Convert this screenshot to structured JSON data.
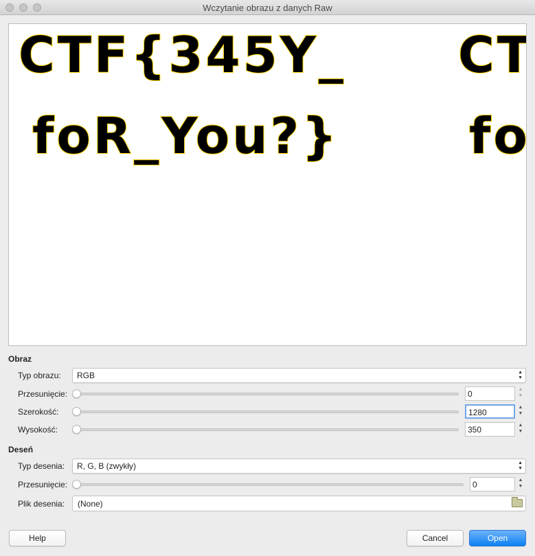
{
  "window": {
    "title": "Wczytanie obrazu z danych Raw"
  },
  "preview": {
    "line1": "CTF{345Y_",
    "line1_tail": "CT",
    "line2": "foR_You?}",
    "line2_tail": "fo"
  },
  "obraz": {
    "section_label": "Obraz",
    "typ_label": "Typ obrazu:",
    "typ_value": "RGB",
    "offset_label": "Przesunięcie:",
    "offset_value": "0",
    "offset_fraction": 0,
    "width_label": "Szerokość:",
    "width_value": "1280",
    "width_fraction": 0,
    "height_label": "Wysokość:",
    "height_value": "350",
    "height_fraction": 0
  },
  "desen": {
    "section_label": "Deseń",
    "typ_label": "Typ desenia:",
    "typ_value": "R, G, B (zwykły)",
    "offset_label": "Przesunięcie:",
    "offset_value": "0",
    "offset_fraction": 0,
    "file_label": "Plik desenia:",
    "file_value": "(None)"
  },
  "buttons": {
    "help": "Help",
    "cancel": "Cancel",
    "open": "Open"
  },
  "colors": {
    "accent": "#0d80f2",
    "focus": "#6fa6e8"
  }
}
